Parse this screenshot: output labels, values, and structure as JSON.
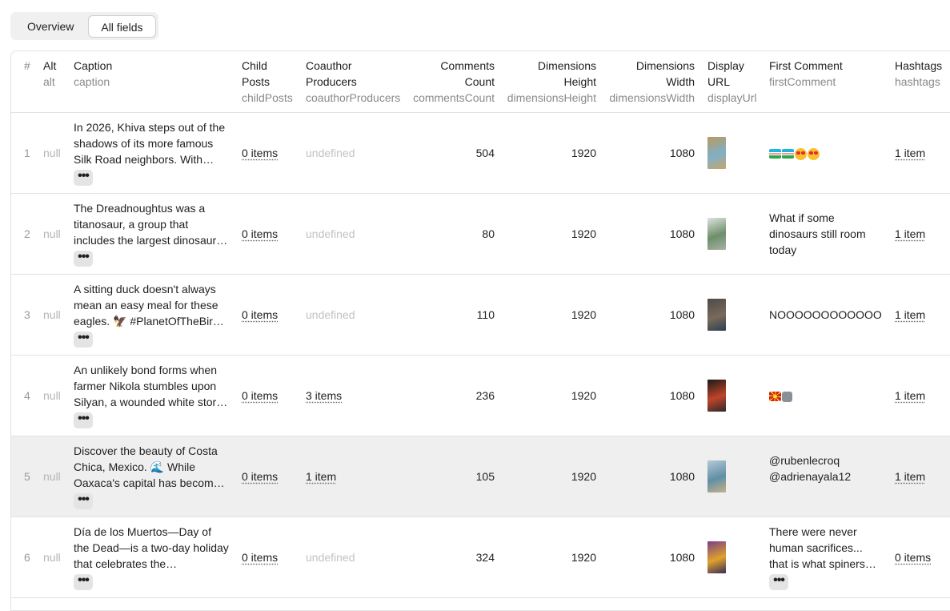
{
  "tabs": {
    "overview": "Overview",
    "all_fields": "All fields"
  },
  "columns": {
    "index": {
      "label": "#"
    },
    "alt": {
      "label": "Alt",
      "key": "alt"
    },
    "caption": {
      "label": "Caption",
      "key": "caption"
    },
    "childPosts": {
      "label1": "Child",
      "label2": "Posts",
      "key": "childPosts"
    },
    "coauthor": {
      "label1": "Coauthor",
      "label2": "Producers",
      "key": "coauthorProducers"
    },
    "comments": {
      "label1": "Comments",
      "label2": "Count",
      "key": "commentsCount"
    },
    "dimH": {
      "label1": "Dimensions",
      "label2": "Height",
      "key": "dimensionsHeight"
    },
    "dimW": {
      "label1": "Dimensions",
      "label2": "Width",
      "key": "dimensionsWidth"
    },
    "display": {
      "label1": "Display",
      "label2": "URL",
      "key": "displayUrl"
    },
    "firstComment": {
      "label": "First Comment",
      "key": "firstComment"
    },
    "hashtags": {
      "label": "Hashtags",
      "key": "hashtags"
    }
  },
  "rows": [
    {
      "index": "1",
      "alt": "null",
      "caption": "In 2026, Khiva steps out of the shadows of its more famous Silk Road neighbors. With…",
      "more": "•••",
      "childPosts": "0 items",
      "coauthor": "undefined",
      "comments": "504",
      "height": "1920",
      "width": "1080",
      "thumb_colors": [
        "#b89a5c",
        "#7fb0c8",
        "#c8a56a"
      ],
      "firstComment": "",
      "firstComment_emoji": [
        "flag-uz",
        "flag-uz",
        "heart-eyes",
        "heart-eyes"
      ],
      "hashtags": "1 item"
    },
    {
      "index": "2",
      "alt": "null",
      "caption": "The Dreadnoughtus was a titanosaur, a group that includes the largest dinosaur…",
      "more": "•••",
      "childPosts": "0 items",
      "coauthor": "undefined",
      "comments": "80",
      "height": "1920",
      "width": "1080",
      "thumb_colors": [
        "#dfe3df",
        "#6d8f6a",
        "#a7b3a4"
      ],
      "firstComment": "What if some dinosaurs still room today",
      "hashtags": "1 item"
    },
    {
      "index": "3",
      "alt": "null",
      "caption": "A sitting duck doesn't always mean an easy meal for these eagles. 🦅 #PlanetOfTheBir…",
      "more": "•••",
      "childPosts": "0 items",
      "coauthor": "undefined",
      "comments": "110",
      "height": "1920",
      "width": "1080",
      "thumb_colors": [
        "#4a4a4a",
        "#7a6a5a",
        "#2c3e50"
      ],
      "firstComment": "NOOOOOOOOOOOO",
      "hashtags": "1 item"
    },
    {
      "index": "4",
      "alt": "null",
      "caption": "An unlikely bond forms when farmer Nikola stumbles upon Silyan, a wounded white stor…",
      "more": "•••",
      "childPosts": "0 items",
      "coauthor": "3 items",
      "comments": "236",
      "height": "1920",
      "width": "1080",
      "thumb_colors": [
        "#1a1a1a",
        "#c0442a",
        "#2a2a2a"
      ],
      "firstComment": "",
      "firstComment_emoji": [
        "flag-mk",
        "cow"
      ],
      "hashtags": "1 item"
    },
    {
      "index": "5",
      "alt": "null",
      "caption": "Discover the beauty of Costa Chica, Mexico. 🌊 While Oaxaca's capital has becom…",
      "more": "•••",
      "childPosts": "0 items",
      "coauthor": "1 item",
      "comments": "105",
      "height": "1920",
      "width": "1080",
      "thumb_colors": [
        "#b5c9d6",
        "#5f8fa6",
        "#c7b08a"
      ],
      "firstComment": "@rubenlecroq @adrienayala12",
      "hashtags": "1 item",
      "highlighted": true
    },
    {
      "index": "6",
      "alt": "null",
      "caption": "Día de los Muertos—Day of the Dead—is a two-day holiday that celebrates the…",
      "more": "•••",
      "childPosts": "0 items",
      "coauthor": "undefined",
      "comments": "324",
      "height": "1920",
      "width": "1080",
      "thumb_colors": [
        "#7a3f8a",
        "#e0a22a",
        "#3a2a5a"
      ],
      "firstComment": "There were never human sacrifices... that is what spiners…",
      "firstComment_more": "•••",
      "hashtags": "0 items"
    }
  ]
}
